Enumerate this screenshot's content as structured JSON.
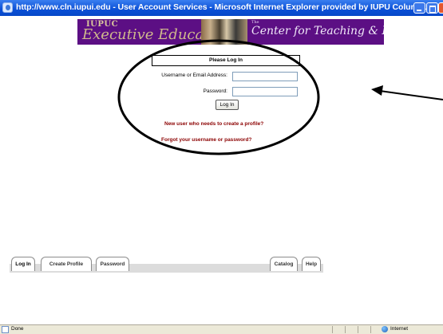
{
  "window": {
    "title": "http://www.cln.iupui.edu - User Account Services - Microsoft Internet Explorer provided by IUPU Columbus",
    "minimize_icon": "minimize-icon",
    "maximize_icon": "maximize-icon",
    "close_icon": "close-icon"
  },
  "banner": {
    "iupuc": "IUPUC",
    "executive_education": "Executive Education",
    "the": "The",
    "center": "Center for Teaching & Learning"
  },
  "login": {
    "header": "Please Log In",
    "username_label": "Username or Email Address:",
    "username_value": "",
    "password_label": "Password:",
    "password_value": "",
    "button_label": "Log In",
    "new_user_link": "New user who needs to create a profile?",
    "forgot_link": "Forgot your username or password?"
  },
  "tabs": {
    "login": "Log In",
    "create_profile": "Create Profile",
    "password": "Password",
    "catalog": "Catalog",
    "help": "Help"
  },
  "statusbar": {
    "status": "Done",
    "zone": "Internet"
  },
  "colors": {
    "banner_bg": "#5c0f84",
    "link": "#8b0000",
    "titlebar": "#0a4fd6"
  }
}
